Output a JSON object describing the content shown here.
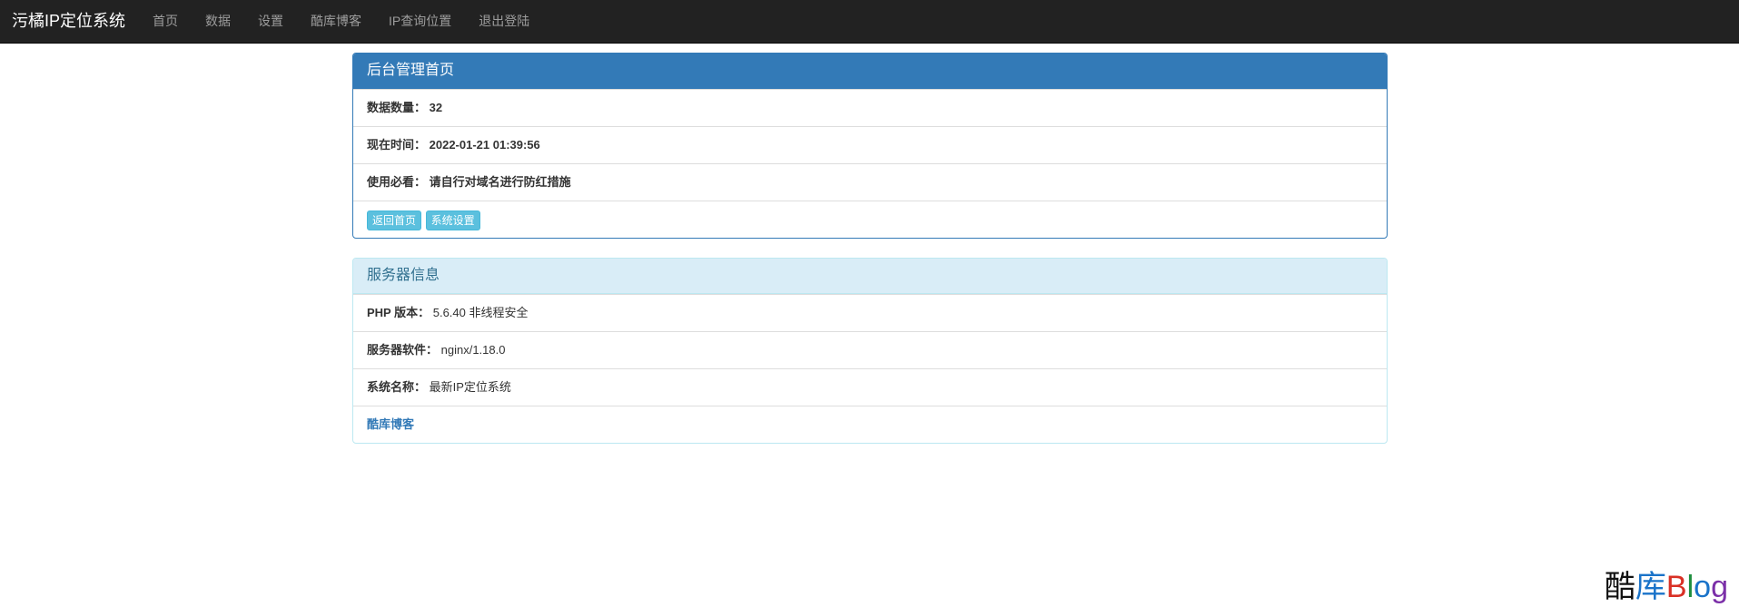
{
  "navbar": {
    "brand": "污橘IP定位系统",
    "items": [
      "首页",
      "数据",
      "设置",
      "酷库博客",
      "IP查询位置",
      "退出登陆"
    ]
  },
  "admin_panel": {
    "title": "后台管理首页",
    "data_count_label": "数据数量：",
    "data_count_value": "32",
    "time_label": "现在时间：",
    "time_value": "2022-01-21 01:39:56",
    "notice_label": "使用必看：",
    "notice_value": "请自行对域名进行防红措施",
    "buttons": [
      "返回首页",
      "系统设置"
    ]
  },
  "server_panel": {
    "title": "服务器信息",
    "php_label": "PHP 版本：",
    "php_value": "5.6.40 非线程安全",
    "software_label": "服务器软件：",
    "software_value": "nginx/1.18.0",
    "system_label": "系统名称：",
    "system_value": "最新IP定位系统",
    "blog_link": "酷库博客"
  },
  "watermark": {
    "part1": "酷",
    "part2": "库",
    "b": "B",
    "l": "l",
    "o": "o",
    "g": "g"
  },
  "colors": {
    "navbar_bg": "#222222",
    "primary": "#337ab7",
    "info_bg": "#d9edf7",
    "button_info": "#5bc0de"
  }
}
